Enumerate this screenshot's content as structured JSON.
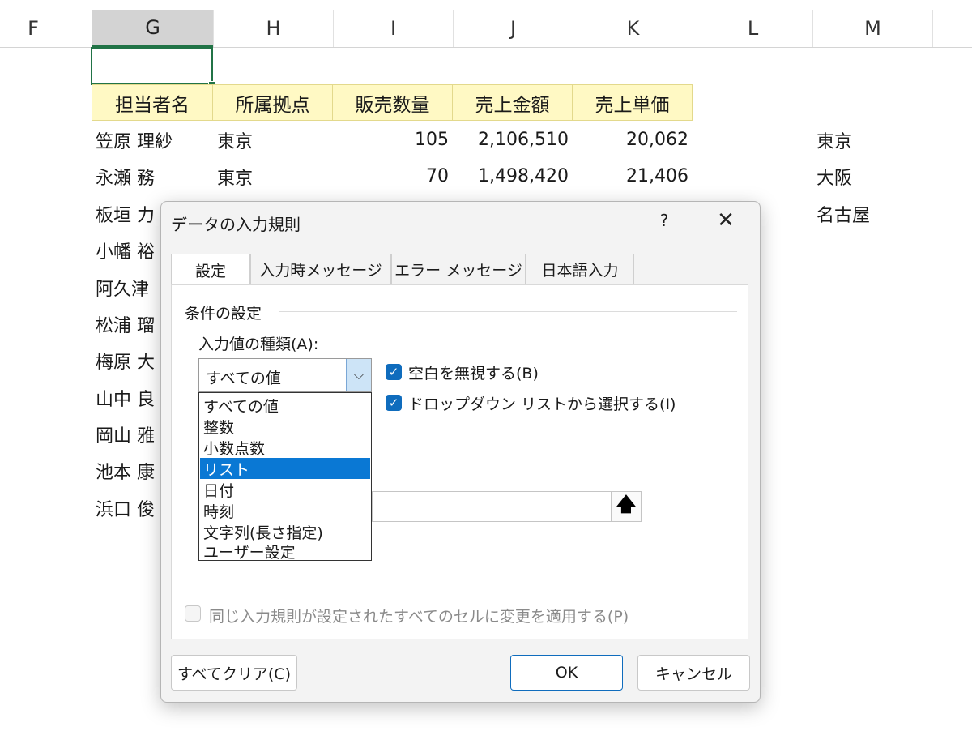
{
  "sheet": {
    "columns": [
      "F",
      "G",
      "H",
      "I",
      "J",
      "K",
      "L",
      "M"
    ],
    "headers": [
      "担当者名",
      "所属拠点",
      "販売数量",
      "売上金額",
      "売上単価"
    ],
    "rows": [
      {
        "name": "笠原 理紗",
        "branch": "東京",
        "qty": "105",
        "amount": "2,106,510",
        "unit": "20,062"
      },
      {
        "name": "永瀬 務",
        "branch": "東京",
        "qty": "70",
        "amount": "1,498,420",
        "unit": "21,406"
      },
      {
        "name": "板垣 力"
      },
      {
        "name": "小幡 裕"
      },
      {
        "name": "阿久津"
      },
      {
        "name": "松浦 瑠"
      },
      {
        "name": "梅原 大"
      },
      {
        "name": "山中 良"
      },
      {
        "name": "岡山 雅"
      },
      {
        "name": "池本 康"
      },
      {
        "name": "浜口 俊"
      }
    ],
    "m_column": [
      "東京",
      "大阪",
      "名古屋"
    ]
  },
  "dialog": {
    "title": "データの入力規則",
    "help": "?",
    "close": "✕",
    "tabs": [
      "設定",
      "入力時メッセージ",
      "エラー メッセージ",
      "日本語入力"
    ],
    "group_label": "条件の設定",
    "allow_label": "入力値の種類(A):",
    "allow_value": "すべての値",
    "chevron": "⌵",
    "ignore_blank": {
      "label": "空白を無視する(B)",
      "checked": true
    },
    "dropdown": {
      "label": "ドロップダウン リストから選択する(I)",
      "checked": true
    },
    "options": [
      "すべての値",
      "整数",
      "小数点数",
      "リスト",
      "日付",
      "時刻",
      "文字列(長さ指定)",
      "ユーザー設定"
    ],
    "selected_option": "リスト",
    "ref_arrow": "🡅",
    "apply_all": {
      "label": "同じ入力規則が設定されたすべてのセルに変更を適用する(P)",
      "checked": false
    },
    "buttons": {
      "clear": "すべてクリア(C)",
      "ok": "OK",
      "cancel": "キャンセル"
    }
  },
  "colors": {
    "selection": "#0a78d4",
    "checkbox": "#0f6cbd",
    "header_fill": "#fff9c4",
    "excel_green": "#217346"
  }
}
